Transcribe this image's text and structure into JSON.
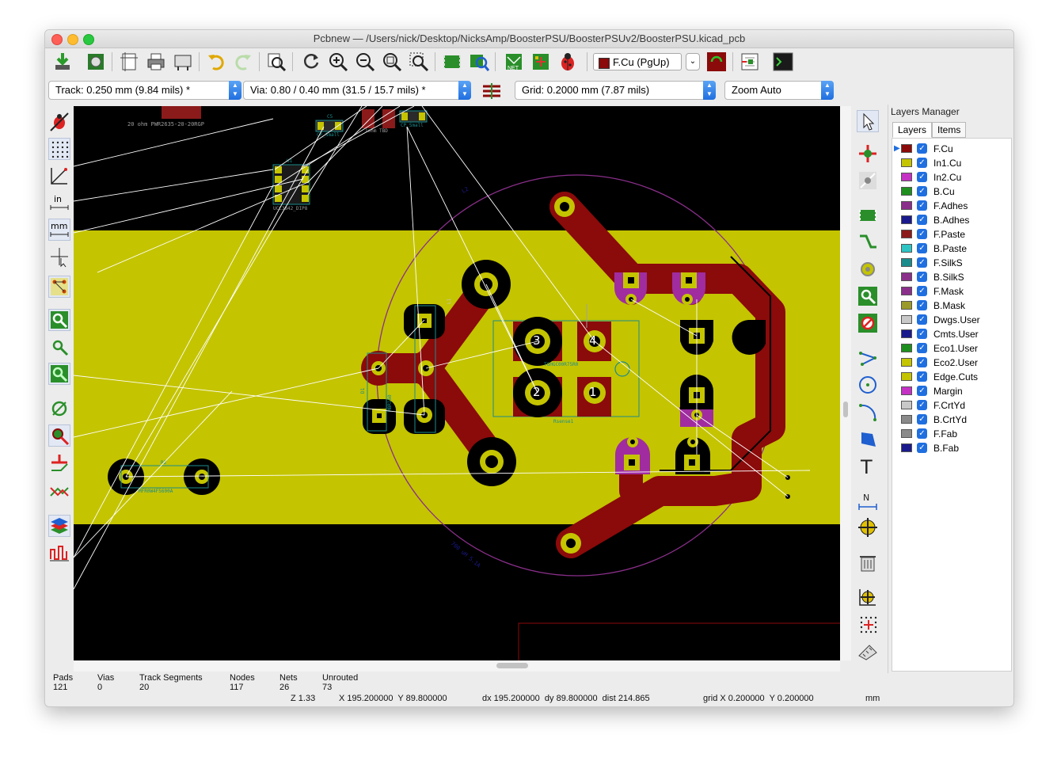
{
  "window": {
    "title": "Pcbnew — /Users/nick/Desktop/NicksAmp/BoosterPSU/BoosterPSUv2/BoosterPSU.kicad_pcb",
    "controls": [
      "close",
      "minimize",
      "zoom"
    ]
  },
  "toolbar": {
    "active_layer": "F.Cu (PgUp)",
    "layer_color": "#8b0a0a"
  },
  "toolbar2": {
    "track": "Track: 0.250 mm (9.84 mils) *",
    "via": "Via: 0.80 / 0.40 mm (31.5 / 15.7 mils) *",
    "grid": "Grid: 0.2000 mm (7.87 mils)",
    "zoom": "Zoom Auto"
  },
  "pcb_labels": {
    "r_top": "20 ohm PWR2635-20-20RGP",
    "u1_ref": "U1",
    "u1_val": "UCC3842_DIP8",
    "c5": "C5",
    "cp_small_a": "CP_Small",
    "cp_small_b": "CP_Small",
    "r_mid": "1ohm TBD",
    "q1": "D1",
    "r2_ref": "R2",
    "r2_val": "MFR0W4F5600A",
    "rsense": "Rsense1",
    "rsense_val": "TGHGC00R75R0",
    "rsense_pad3": "3",
    "rsense_pad4": "4",
    "rsense_pad2": "2",
    "rsense_pad1": "1",
    "inductor_lbl": "L1",
    "d1_val": "MBR160",
    "coil_lbl": "700 uH 5.1A",
    "coil_ref": "L2"
  },
  "layers_manager": {
    "title": "Layers Manager",
    "tabs": [
      "Layers",
      "Items"
    ],
    "layers": [
      {
        "name": "F.Cu",
        "color": "#8b0a0a",
        "active": true
      },
      {
        "name": "In1.Cu",
        "color": "#c4c400"
      },
      {
        "name": "In2.Cu",
        "color": "#c431c4"
      },
      {
        "name": "B.Cu",
        "color": "#1e8f1e"
      },
      {
        "name": "F.Adhes",
        "color": "#8a2f8a"
      },
      {
        "name": "B.Adhes",
        "color": "#1a1a8c"
      },
      {
        "name": "F.Paste",
        "color": "#8b1a1a"
      },
      {
        "name": "B.Paste",
        "color": "#2ec4c4"
      },
      {
        "name": "F.SilkS",
        "color": "#1b8c8c"
      },
      {
        "name": "B.SilkS",
        "color": "#8a2f8a"
      },
      {
        "name": "F.Mask",
        "color": "#8a2f8a"
      },
      {
        "name": "B.Mask",
        "color": "#9a9a2a"
      },
      {
        "name": "Dwgs.User",
        "color": "#c8c8c8"
      },
      {
        "name": "Cmts.User",
        "color": "#1a1a8c"
      },
      {
        "name": "Eco1.User",
        "color": "#1e8f1e"
      },
      {
        "name": "Eco2.User",
        "color": "#c4c400"
      },
      {
        "name": "Edge.Cuts",
        "color": "#c4c400"
      },
      {
        "name": "Margin",
        "color": "#c431c4"
      },
      {
        "name": "F.CrtYd",
        "color": "#c8c8c8"
      },
      {
        "name": "B.CrtYd",
        "color": "#8a8a8a"
      },
      {
        "name": "F.Fab",
        "color": "#8a8a8a"
      },
      {
        "name": "B.Fab",
        "color": "#1a1a8c"
      }
    ]
  },
  "status": {
    "pads_label": "Pads",
    "pads": "121",
    "vias_label": "Vias",
    "vias": "0",
    "tracks_label": "Track Segments",
    "tracks": "20",
    "nodes_label": "Nodes",
    "nodes": "117",
    "nets_label": "Nets",
    "nets": "26",
    "unrouted_label": "Unrouted",
    "unrouted": "73",
    "zoom": "Z 1.33",
    "xy": "X 195.200000  Y 89.800000",
    "delta": "dx 195.200000  dy 89.800000  dist 214.865",
    "grid": "grid X 0.200000  Y 0.200000",
    "units": "mm"
  }
}
